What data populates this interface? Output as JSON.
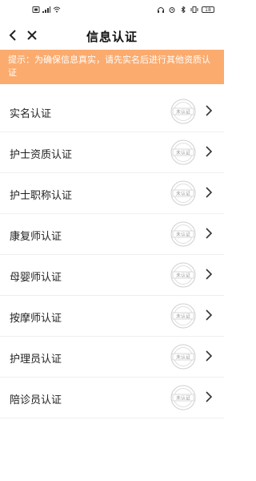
{
  "status_bar": {
    "left_icons": [
      "sim-icon",
      "signal-icon",
      "wifi-icon"
    ],
    "right_icons": [
      "headphone-icon",
      "alarm-icon",
      "bluetooth-icon",
      "vibrate-icon"
    ],
    "battery": "18"
  },
  "header": {
    "title": "信息认证",
    "back_icon": "chevron-left-icon",
    "close_icon": "close-icon"
  },
  "notice": {
    "text": "提示：为确保信息真实，请先实名后进行其他资质认证",
    "bg_color": "#fbab6e"
  },
  "items": [
    {
      "label": "实名认证",
      "status": "未认证"
    },
    {
      "label": "护士资质认证",
      "status": "未认证"
    },
    {
      "label": "护士职称认证",
      "status": "未认证"
    },
    {
      "label": "康复师认证",
      "status": "未认证"
    },
    {
      "label": "母婴师认证",
      "status": "未认证"
    },
    {
      "label": "按摩师认证",
      "status": "未认证"
    },
    {
      "label": "护理员认证",
      "status": "未认证"
    },
    {
      "label": "陪诊员认证",
      "status": "未认证"
    }
  ]
}
